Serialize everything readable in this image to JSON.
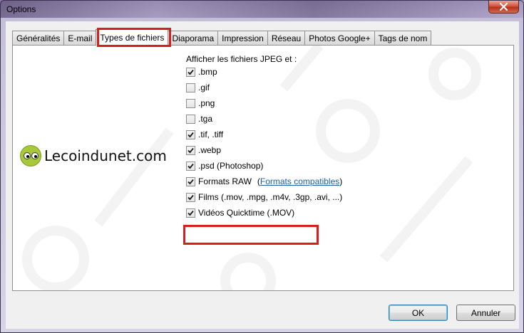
{
  "window": {
    "title": "Options",
    "close_label": "close"
  },
  "tabs": [
    {
      "label": "Généralités"
    },
    {
      "label": "E-mail"
    },
    {
      "label": "Types de fichiers"
    },
    {
      "label": "Diaporama"
    },
    {
      "label": "Impression"
    },
    {
      "label": "Réseau"
    },
    {
      "label": "Photos Google+"
    },
    {
      "label": "Tags de nom"
    }
  ],
  "active_tab": "Types de fichiers",
  "file_types": {
    "heading": "Afficher les fichiers JPEG et :",
    "items": [
      {
        "label": ".bmp",
        "checked": true
      },
      {
        "label": ".gif",
        "checked": false
      },
      {
        "label": ".png",
        "checked": false
      },
      {
        "label": ".tga",
        "checked": false
      },
      {
        "label": ".tif, .tiff",
        "checked": true
      },
      {
        "label": ".webp",
        "checked": true
      },
      {
        "label": ".psd (Photoshop)",
        "checked": true
      },
      {
        "label": "Formats RAW",
        "checked": true,
        "link_prefix": "(",
        "link": "Formats compatibles",
        "link_suffix": ")"
      },
      {
        "label": "Films (.mov, .mpg, .m4v, .3gp, .avi, ...)",
        "checked": true
      },
      {
        "label": "Vidéos Quicktime (.MOV)",
        "checked": true
      }
    ]
  },
  "logo": {
    "text": "Lecoindunet.com"
  },
  "buttons": {
    "ok": "OK",
    "cancel": "Annuler"
  },
  "colors": {
    "highlight": "#d81d1d",
    "link": "#1a5ea8",
    "logo_face": "#a6c83a"
  }
}
